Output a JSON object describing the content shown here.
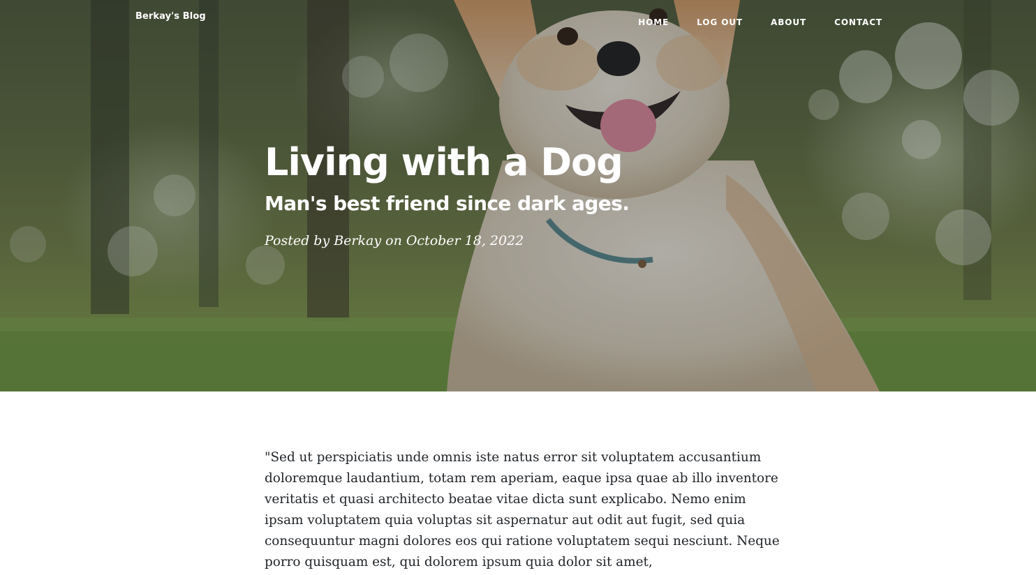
{
  "nav": {
    "brand": "Berkay's Blog",
    "links": [
      "HOME",
      "LOG OUT",
      "ABOUT",
      "CONTACT"
    ]
  },
  "post": {
    "title": "Living with a Dog",
    "subtitle": "Man's best friend since dark ages.",
    "meta": "Posted by Berkay on October 18, 2022"
  },
  "article": {
    "body": "\"Sed ut perspiciatis unde omnis iste natus error sit voluptatem accusantium doloremque laudantium, totam rem aperiam, eaque ipsa quae ab illo inventore veritatis et quasi architecto beatae vitae dicta sunt explicabo. Nemo enim ipsam voluptatem quia voluptas sit aspernatur aut odit aut fugit, sed quia consequuntur magni dolores eos qui ratione voluptatem sequi nesciunt. Neque porro quisquam est, qui dolorem ipsum quia dolor sit amet,"
  },
  "colors": {
    "text_dark": "#212529",
    "hero_overlay": "#212529",
    "nav_text": "#ffffff"
  }
}
